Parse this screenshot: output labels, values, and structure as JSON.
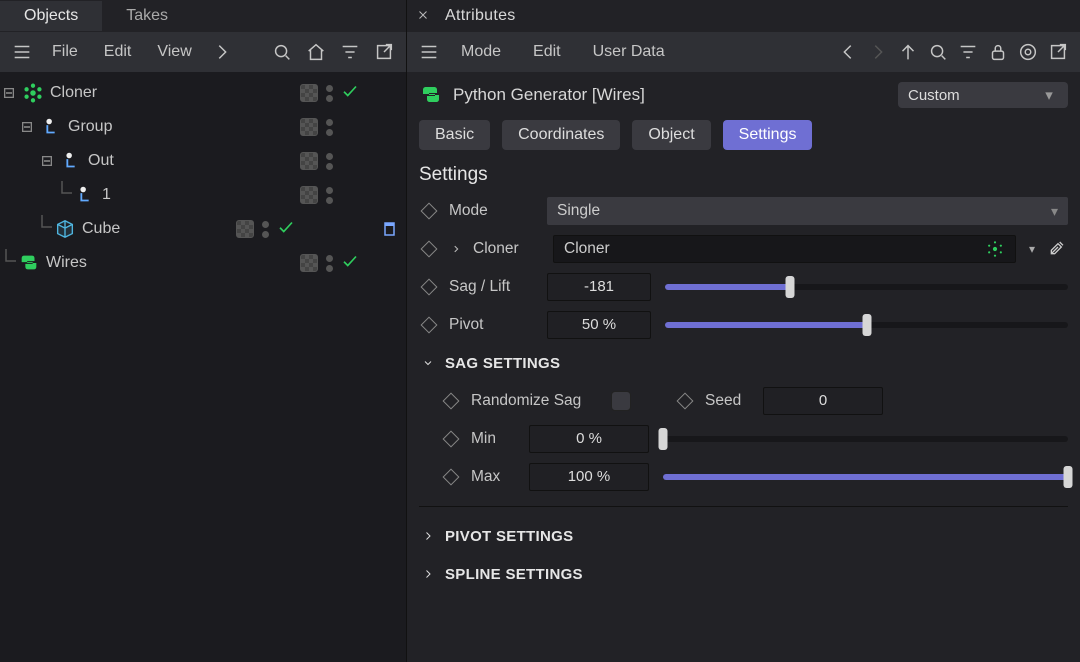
{
  "left": {
    "tabs": [
      "Objects",
      "Takes"
    ],
    "menu": [
      "File",
      "Edit",
      "View"
    ],
    "tree": [
      {
        "id": "cloner",
        "label": "Cloner",
        "depth": 0,
        "icon": "cloner",
        "check": true
      },
      {
        "id": "group",
        "label": "Group",
        "depth": 1,
        "icon": "null",
        "check": false
      },
      {
        "id": "out",
        "label": "Out",
        "depth": 2,
        "icon": "null",
        "check": false
      },
      {
        "id": "one",
        "label": "1",
        "depth": 3,
        "icon": "null",
        "check": false
      },
      {
        "id": "cube",
        "label": "Cube",
        "depth": 2,
        "icon": "cube",
        "check": true,
        "tag": true
      },
      {
        "id": "wires",
        "label": "Wires",
        "depth": 0,
        "icon": "python",
        "check": true
      }
    ]
  },
  "right": {
    "title": "Attributes",
    "menu": [
      "Mode",
      "Edit",
      "User Data"
    ],
    "generator_name": "Python Generator [Wires]",
    "preset": "Custom",
    "tabs": {
      "all": [
        "Basic",
        "Coordinates",
        "Object",
        "Settings"
      ],
      "active": "Settings"
    },
    "section_title": "Settings",
    "mode": {
      "label": "Mode",
      "value": "Single"
    },
    "cloner_link": {
      "label": "Cloner",
      "value": "Cloner"
    },
    "sag_lift": {
      "label": "Sag / Lift",
      "value": "-181",
      "slider_fill_pct": 31,
      "slider_thumb_pct": 31
    },
    "pivot": {
      "label": "Pivot",
      "value": "50 %",
      "slider_fill_pct": 50,
      "slider_thumb_pct": 50
    },
    "group_sag": {
      "title": "SAG SETTINGS",
      "randomize_label": "Randomize Sag",
      "seed": {
        "label": "Seed",
        "value": "0"
      },
      "min": {
        "label": "Min",
        "value": "0 %",
        "slider_fill_pct": 0,
        "slider_thumb_pct": 0
      },
      "max": {
        "label": "Max",
        "value": "100 %",
        "slider_fill_pct": 100,
        "slider_thumb_pct": 100
      }
    },
    "group_pivot_title": "PIVOT SETTINGS",
    "group_spline_title": "SPLINE SETTINGS"
  },
  "colors": {
    "accent": "#6f6fd3",
    "green": "#2fce5e",
    "panel": "#2f3035",
    "bg": "#222226"
  }
}
